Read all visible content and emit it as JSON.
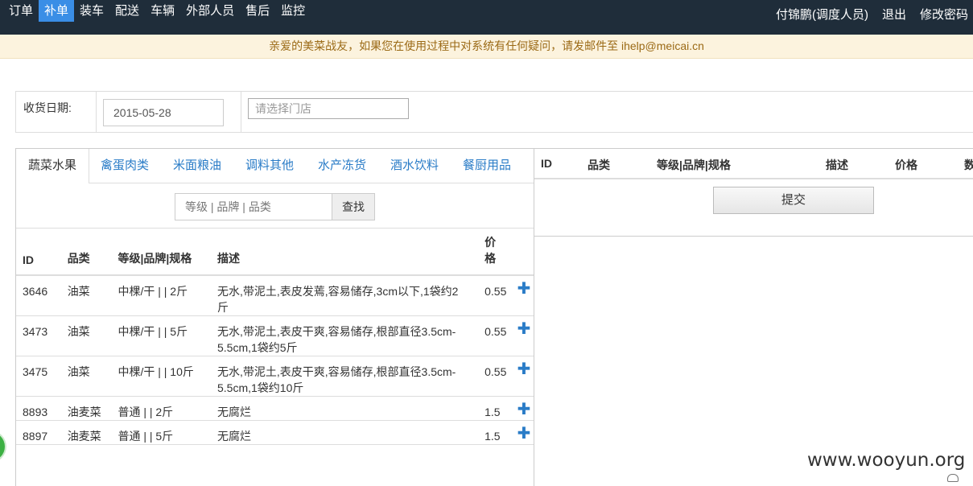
{
  "nav": {
    "items": [
      "订单",
      "补单",
      "装车",
      "配送",
      "车辆",
      "外部人员",
      "售后",
      "监控"
    ],
    "active_index": 1,
    "user": "付锦鹏(调度人员)",
    "logout": "退出",
    "change_password": "修改密码"
  },
  "notice": "亲爱的美菜战友，如果您在使用过程中对系统有任何疑问，请发邮件至 ihelp@meicai.cn",
  "filter": {
    "date_label": "收货日期:",
    "date_value": "2015-05-28",
    "store_placeholder": "请选择门店"
  },
  "tabs": [
    "蔬菜水果",
    "禽蛋肉类",
    "米面粮油",
    "调料其他",
    "水产冻货",
    "酒水饮料",
    "餐厨用品"
  ],
  "search": {
    "placeholder": "等级 | 品牌 | 品类",
    "button": "查找"
  },
  "product_table": {
    "headers": [
      "ID",
      "品类",
      "等级|品牌|规格",
      "描述",
      "价格"
    ],
    "rows": [
      {
        "id": "3646",
        "category": "油菜",
        "spec": "中棵/干 | | 2斤",
        "desc": "无水,带泥土,表皮发蔫,容易储存,3cm以下,1袋约2斤",
        "price": "0.55"
      },
      {
        "id": "3473",
        "category": "油菜",
        "spec": "中棵/干 | | 5斤",
        "desc": "无水,带泥土,表皮干爽,容易储存,根部直径3.5cm-5.5cm,1袋约5斤",
        "price": "0.55"
      },
      {
        "id": "3475",
        "category": "油菜",
        "spec": "中棵/干 | | 10斤",
        "desc": "无水,带泥土,表皮干爽,容易储存,根部直径3.5cm-5.5cm,1袋约10斤",
        "price": "0.55"
      },
      {
        "id": "8893",
        "category": "油麦菜",
        "spec": "普通 | | 2斤",
        "desc": "无腐烂",
        "price": "1.5"
      },
      {
        "id": "8897",
        "category": "油麦菜",
        "spec": "普通 | | 5斤",
        "desc": "无腐烂",
        "price": "1.5"
      }
    ],
    "add_icon": "plus-icon"
  },
  "cart": {
    "headers": [
      "ID",
      "品类",
      "等级|品牌|规格",
      "描述",
      "价格",
      "数"
    ],
    "submit": "提交"
  },
  "watermark": "www.wooyun.org",
  "colors": {
    "nav_bg": "#1f2d3a",
    "nav_active": "#3a8ee6",
    "link": "#2a7cc7",
    "notice_bg": "#fcf3de",
    "notice_text": "#9b6a16"
  }
}
